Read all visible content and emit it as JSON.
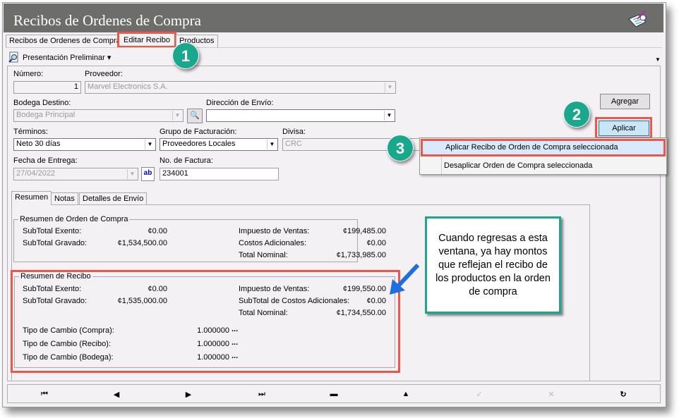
{
  "window": {
    "title": "Recibos de Ordenes de Compra",
    "icon": "notepad-writing-icon"
  },
  "tabs": [
    {
      "label": "Recibos de Ordenes de Compra"
    },
    {
      "label": "Editar Recibo",
      "active": true
    },
    {
      "label": "Productos"
    }
  ],
  "toolbar": {
    "preview_label": "Presentación Preliminar ▾"
  },
  "form": {
    "numero_label": "Número:",
    "numero_value": "1",
    "proveedor_label": "Proveedor:",
    "proveedor_value": "Marvel Electronics S.A.",
    "bodega_label": "Bodega Destino:",
    "bodega_value": "Bodega Principal",
    "direccion_label": "Dirección de Envío:",
    "direccion_value": "",
    "terminos_label": "Términos:",
    "terminos_value": "Neto 30 días",
    "grupo_label": "Grupo de Facturación:",
    "grupo_value": "Proveedores Locales",
    "divisa_label": "Divisa:",
    "divisa_value": "CRC",
    "fecha_label": "Fecha de Entrega:",
    "fecha_value": "27/04/2022",
    "factura_label": "No. de Factura:",
    "factura_value": "234001"
  },
  "buttons": {
    "agregar": "Agregar",
    "aplicar": "Aplicar"
  },
  "menu": {
    "items": [
      "Aplicar Recibo de Orden de Compra seleccionada",
      "Desaplicar Orden de Compra seleccionada"
    ]
  },
  "subtabs": [
    "Resumen",
    "Notas",
    "Detalles de Envío"
  ],
  "orden": {
    "title": "Resumen de Orden de Compra",
    "rows": [
      [
        "SubTotal Exento:",
        "¢0.00",
        "Impuesto de Ventas:",
        "¢199,485.00"
      ],
      [
        "SubTotal Gravado:",
        "¢1,534,500.00",
        "Costos Adicionales:",
        "¢0.00"
      ],
      [
        "",
        "",
        "Total Nominal:",
        "¢1,733,985.00"
      ]
    ]
  },
  "recibo": {
    "title": "Resumen de Recibo",
    "rows": [
      [
        "SubTotal Exento:",
        "¢0.00",
        "Impuesto de Ventas:",
        "¢199,550.00"
      ],
      [
        "SubTotal Gravado:",
        "¢1,535,000.00",
        "SubTotal de Costos Adicionales:",
        "¢0.00"
      ],
      [
        "",
        "",
        "Total Nominal:",
        "¢1,734,550.00"
      ]
    ],
    "cambio": [
      [
        "Tipo de Cambio (Compra):",
        "1.000000",
        "..."
      ],
      [
        "Tipo de Cambio (Recibo):",
        "1.000000",
        "..."
      ],
      [
        "Tipo de Cambio (Bodega):",
        "1.000000",
        "..."
      ]
    ]
  },
  "callout": {
    "text": "Cuando regresas a esta ventana, ya hay montos que reflejan el recibo de los productos en la orden de compra"
  },
  "steps": [
    "1",
    "2",
    "3"
  ],
  "nav": {
    "first": "⏮",
    "prev": "◀",
    "next": "▶",
    "last": "⏭",
    "delete": "▬",
    "up": "▲",
    "accept": "✓",
    "cancel": "✕",
    "refresh": "↻"
  },
  "colors": {
    "highlight": "#f0554a",
    "step": "#1aa88d",
    "arrow": "#1e6fe0"
  }
}
